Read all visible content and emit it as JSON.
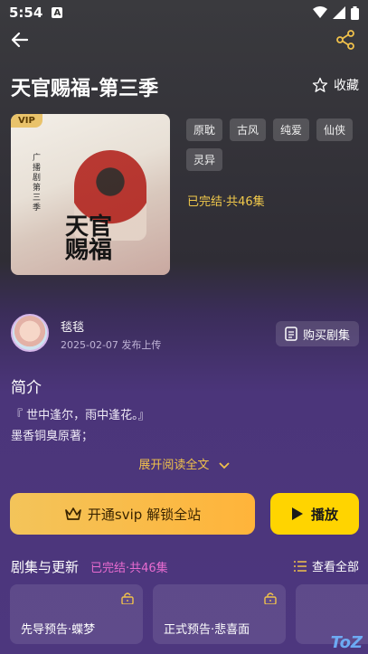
{
  "status_bar": {
    "time": "5:54",
    "notification_icon": "A"
  },
  "header": {
    "title": "天官赐福-第三季",
    "favorite_label": "收藏"
  },
  "cover": {
    "vip_badge": "VIP",
    "title_text": "天官\n赐福",
    "side_text": "广\n播\n剧\n第\n三\n季"
  },
  "tags": [
    "原耽",
    "古风",
    "纯爱",
    "仙侠",
    "灵异"
  ],
  "status_text": "已完结·共46集",
  "author": {
    "name": "毯毯",
    "date": "2025-02-07 发布上传"
  },
  "buy_button_label": "购买剧集",
  "intro": {
    "title": "简介",
    "line1": "『 世中逢尔，雨中逢花。』",
    "line2": "墨香铜臭原著；"
  },
  "expand_label": "展开阅读全文",
  "actions": {
    "vip_label": "开通svip 解锁全站",
    "play_label": "播放"
  },
  "episodes": {
    "title": "剧集与更新",
    "status": "已完结·共46集",
    "view_all": "查看全部",
    "items": [
      {
        "label": "先导预告·蝶梦"
      },
      {
        "label": "正式预告·悲喜面"
      },
      {
        "label": ""
      }
    ]
  },
  "watermark": "ToZ",
  "colors": {
    "accent_gold": "#f0c14b",
    "play_yellow": "#ffd400",
    "episode_pink": "#e86bd0"
  }
}
